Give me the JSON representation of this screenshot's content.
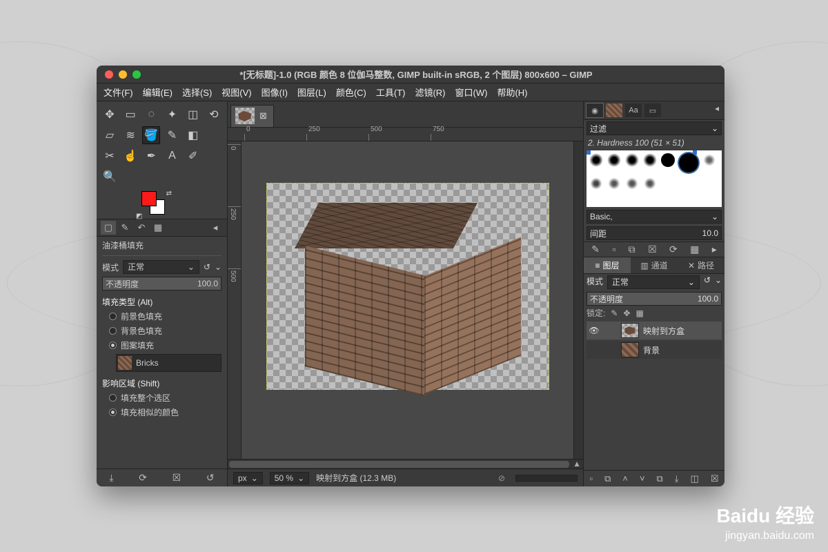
{
  "window": {
    "title": "*[无标题]-1.0 (RGB 颜色 8 位伽马整数, GIMP built-in sRGB, 2 个图层) 800x600 – GIMP"
  },
  "menu": {
    "file": "文件(F)",
    "edit": "编辑(E)",
    "select": "选择(S)",
    "view": "视图(V)",
    "image": "图像(I)",
    "layer": "图层(L)",
    "colors": "颜色(C)",
    "tools": "工具(T)",
    "filters": "滤镜(R)",
    "windows": "窗口(W)",
    "help": "帮助(H)"
  },
  "tool_options": {
    "title": "油漆桶填充",
    "mode_label": "模式",
    "mode_value": "正常",
    "opacity_label": "不透明度",
    "opacity_value": "100.0",
    "fill_type_title": "填充类型 (Alt)",
    "fill_fg": "前景色填充",
    "fill_bg": "背景色填充",
    "fill_pattern": "图案填充",
    "pattern_name": "Bricks",
    "affect_title": "影响区域 (Shift)",
    "affect_whole": "填充整个选区",
    "affect_similar": "填充相似的颜色"
  },
  "ruler": {
    "t0": "0",
    "t250": "250",
    "t500": "500",
    "t750": "750"
  },
  "status": {
    "unit": "px",
    "zoom": "50 %",
    "message": "映射到方盒 (12.3 MB)"
  },
  "right": {
    "filter_label": "过滤",
    "brush_name": "2. Hardness 100 (51 × 51)",
    "preset_label": "Basic,",
    "spacing_label": "间距",
    "spacing_value": "10.0",
    "tabs": {
      "layers": "图层",
      "channels": "通道",
      "paths": "路径"
    },
    "mode_label": "模式",
    "mode_value": "正常",
    "opacity_label": "不透明度",
    "opacity_value": "100.0",
    "lock_label": "锁定:",
    "layer1": "映射到方盒",
    "layer2": "背景"
  },
  "watermark": {
    "brand": "Baidu 经验",
    "url": "jingyan.baidu.com"
  }
}
